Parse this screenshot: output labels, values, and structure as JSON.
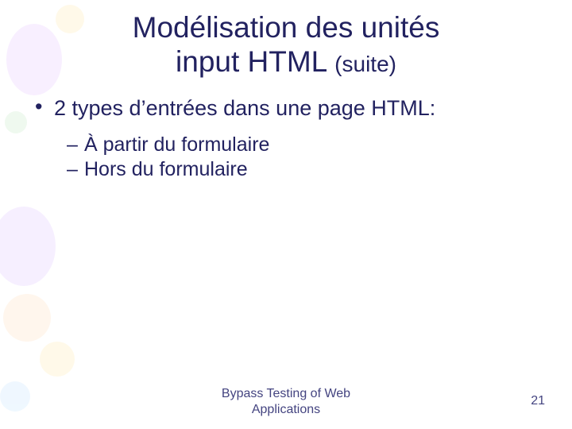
{
  "title": {
    "line1": "Modélisation des unités",
    "line2_main": "input HTML ",
    "line2_sub": "(suite)"
  },
  "bullets": {
    "l1": "2 types d’entrées dans une page HTML:",
    "l2a": "À partir du formulaire",
    "l2b": "Hors du formulaire"
  },
  "footer": {
    "center_line1": "Bypass Testing of Web",
    "center_line2": "Applications",
    "page_number": "21"
  },
  "colors": {
    "text": "#222260"
  }
}
